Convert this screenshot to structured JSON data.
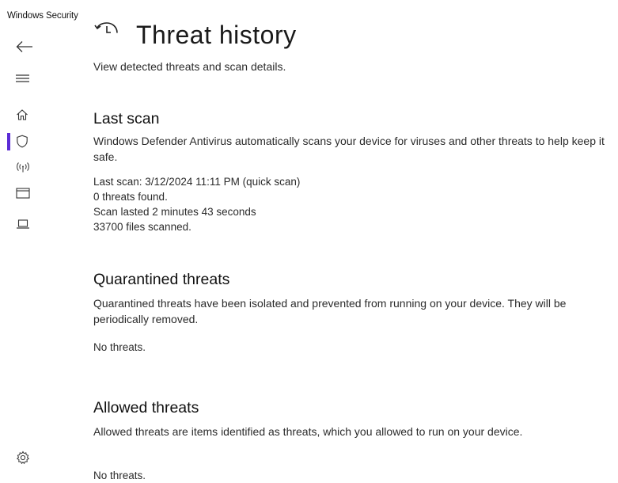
{
  "app": {
    "title": "Windows Security"
  },
  "nav": {
    "items": [
      {
        "id": "back",
        "icon": "back-arrow-icon"
      },
      {
        "id": "menu",
        "icon": "hamburger-menu-icon"
      },
      {
        "id": "home",
        "icon": "home-icon"
      },
      {
        "id": "virus-protection",
        "icon": "shield-icon",
        "active": true
      },
      {
        "id": "firewall",
        "icon": "wireless-antenna-icon"
      },
      {
        "id": "app-browser-control",
        "icon": "app-window-icon"
      },
      {
        "id": "device-security",
        "icon": "laptop-icon"
      },
      {
        "id": "settings",
        "icon": "gear-icon"
      }
    ],
    "active_color": "#5b2bd6"
  },
  "page": {
    "title": "Threat history",
    "subtitle": "View detected threats and scan details."
  },
  "last_scan": {
    "heading": "Last scan",
    "description": "Windows Defender Antivirus automatically scans your device for viruses and other threats to help keep it safe.",
    "details": [
      "Last scan: 3/12/2024 11:11 PM (quick scan)",
      "0 threats found.",
      "Scan lasted 2 minutes 43 seconds",
      "33700 files scanned."
    ]
  },
  "quarantined": {
    "heading": "Quarantined threats",
    "description": "Quarantined threats have been isolated and prevented from running on your device.  They will be periodically removed.",
    "status": "No threats."
  },
  "allowed": {
    "heading": "Allowed threats",
    "description": "Allowed threats are items identified as threats, which you allowed to run on your device.",
    "status": "No threats."
  }
}
